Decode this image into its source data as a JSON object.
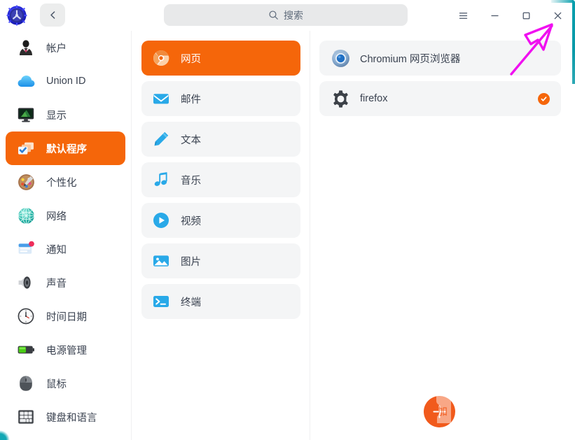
{
  "window": {
    "logo_icon": "settings-gear-logo",
    "back_icon": "chevron-left-icon",
    "accent_color": "#f5660a",
    "frame_accent_color": "#0a9aa8"
  },
  "search": {
    "icon": "search-icon",
    "placeholder": "搜索",
    "value": ""
  },
  "window_controls": [
    {
      "name": "menu-button",
      "icon": "hamburger-icon",
      "label": ""
    },
    {
      "name": "minimize-button",
      "icon": "minimize-icon",
      "label": ""
    },
    {
      "name": "maximize-button",
      "icon": "maximize-icon",
      "label": ""
    },
    {
      "name": "close-button",
      "icon": "close-icon",
      "label": ""
    }
  ],
  "sidebar": {
    "items": [
      {
        "label": "帐户",
        "icon": "account-person-icon",
        "active": false
      },
      {
        "label": "Union ID",
        "icon": "cloud-icon",
        "active": false
      },
      {
        "label": "显示",
        "icon": "display-monitor-icon",
        "active": false
      },
      {
        "label": "默认程序",
        "icon": "default-apps-icon",
        "active": true
      },
      {
        "label": "个性化",
        "icon": "personalization-palette-icon",
        "active": false
      },
      {
        "label": "网络",
        "icon": "network-globe-icon",
        "active": false
      },
      {
        "label": "通知",
        "icon": "notification-icon",
        "active": false
      },
      {
        "label": "声音",
        "icon": "sound-speaker-icon",
        "active": false
      },
      {
        "label": "时间日期",
        "icon": "clock-icon",
        "active": false
      },
      {
        "label": "电源管理",
        "icon": "battery-icon",
        "active": false
      },
      {
        "label": "鼠标",
        "icon": "mouse-icon",
        "active": false
      },
      {
        "label": "键盘和语言",
        "icon": "keyboard-icon",
        "active": false
      }
    ]
  },
  "categories": {
    "items": [
      {
        "label": "网页",
        "icon": "web-browser-icon",
        "active": true
      },
      {
        "label": "邮件",
        "icon": "mail-envelope-icon",
        "active": false
      },
      {
        "label": "文本",
        "icon": "text-pencil-icon",
        "active": false
      },
      {
        "label": "音乐",
        "icon": "music-note-icon",
        "active": false
      },
      {
        "label": "视频",
        "icon": "video-play-icon",
        "active": false
      },
      {
        "label": "图片",
        "icon": "image-picture-icon",
        "active": false
      },
      {
        "label": "终端",
        "icon": "terminal-icon",
        "active": false
      }
    ]
  },
  "apps": {
    "items": [
      {
        "label": "Chromium 网页浏览器",
        "icon": "chromium-icon",
        "default": false
      },
      {
        "label": "firefox",
        "icon": "gear-app-icon",
        "default": true
      }
    ],
    "default_badge_icon": "check-circle-icon"
  },
  "fab": {
    "icon": "plus-icon",
    "label": "",
    "color": "#f15a1c"
  },
  "annotation": {
    "type": "arrow",
    "color": "#f010f0",
    "points_to": "close-button"
  }
}
